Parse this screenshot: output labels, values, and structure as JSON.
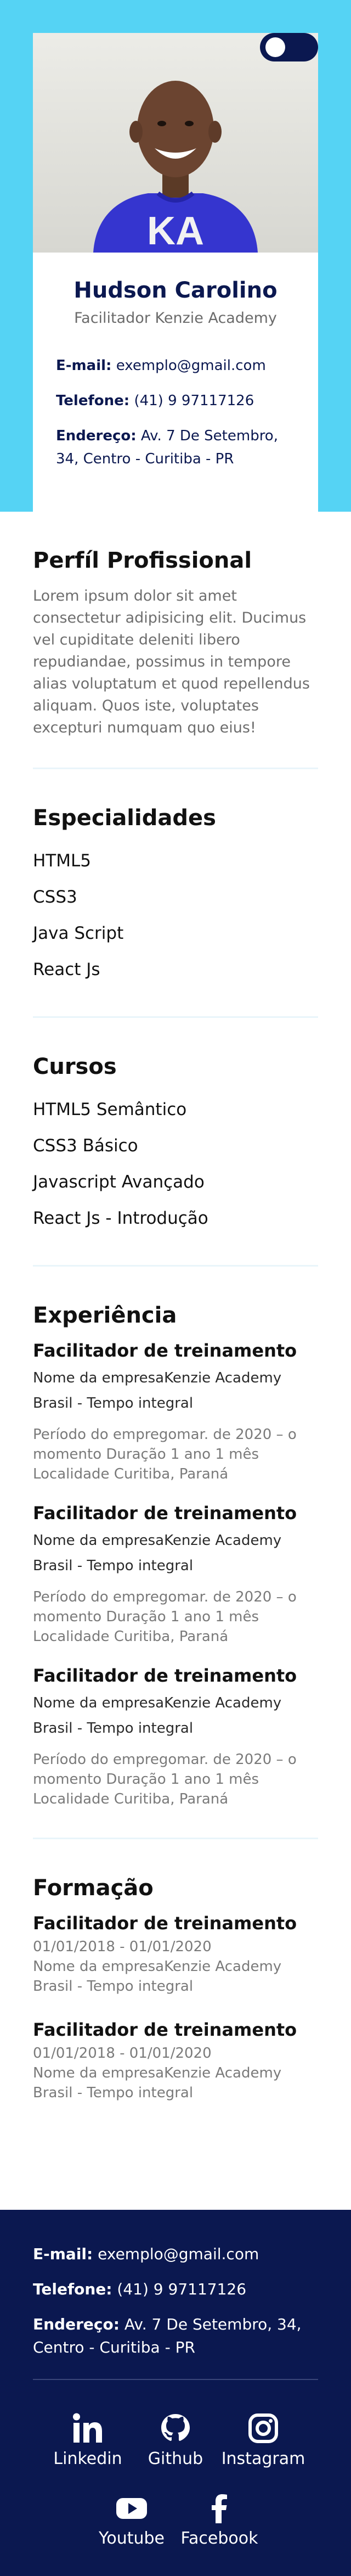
{
  "profile": {
    "name": "Hudson Carolino",
    "role": "Facilitador Kenzie Academy",
    "email_label": "E-mail:",
    "email": "exemplo@gmail.com",
    "phone_label": "Telefone:",
    "phone": "(41) 9 97117126",
    "address_label": "Endereço:",
    "address": "Av. 7 De Setembro, 34, Centro - Curitiba - PR",
    "shirt_logo": "KA"
  },
  "theme": {
    "accent": "#55d3f4",
    "navy": "#0b1850"
  },
  "about": {
    "title": "Perfíl Profissional",
    "text": "Lorem ipsum dolor sit amet consectetur adipisicing elit. Ducimus vel cupiditate deleniti libero repudiandae, possimus in tempore alias voluptatum et quod repellendus aliquam. Quos iste, voluptates excepturi numquam quo eius!"
  },
  "skills": {
    "title": "Especialidades",
    "items": [
      "HTML5",
      "CSS3",
      "Java Script",
      "React Js"
    ]
  },
  "courses": {
    "title": "Cursos",
    "items": [
      "HTML5 Semântico",
      "CSS3 Básico",
      "Javascript Avançado",
      "React Js - Introdução"
    ]
  },
  "experience": {
    "title": "Experiência",
    "items": [
      {
        "role": "Facilitador de treinamento",
        "company": "Nome da empresaKenzie Academy Brasil - Tempo integral",
        "period": "Período do empregomar. de 2020 – o momento Duração 1 ano 1 mês Localidade Curitiba, Paraná"
      },
      {
        "role": "Facilitador de treinamento",
        "company": "Nome da empresaKenzie Academy Brasil - Tempo integral",
        "period": "Período do empregomar. de 2020 – o momento Duração 1 ano 1 mês Localidade Curitiba, Paraná"
      },
      {
        "role": "Facilitador de treinamento",
        "company": "Nome da empresaKenzie Academy Brasil - Tempo integral",
        "period": "Período do empregomar. de 2020 – o momento Duração 1 ano 1 mês Localidade Curitiba, Paraná"
      }
    ]
  },
  "education": {
    "title": "Formação",
    "items": [
      {
        "title": "Facilitador de treinamento",
        "dates": "01/01/2018 - 01/01/2020",
        "school": "Nome da empresaKenzie Academy Brasil - Tempo integral"
      },
      {
        "title": "Facilitador de treinamento",
        "dates": "01/01/2018 - 01/01/2020",
        "school": "Nome da empresaKenzie Academy Brasil - Tempo integral"
      }
    ]
  },
  "footer": {
    "email_label": "E-mail:",
    "email": "exemplo@gmail.com",
    "phone_label": "Telefone:",
    "phone": "(41) 9 97117126",
    "address_label": "Endereço:",
    "address": "Av. 7 De Setembro, 34, Centro - Curitiba - PR",
    "socials": [
      {
        "label": "Linkedin",
        "icon": "linkedin-icon"
      },
      {
        "label": "Github",
        "icon": "github-icon"
      },
      {
        "label": "Instagram",
        "icon": "instagram-icon"
      },
      {
        "label": "Youtube",
        "icon": "youtube-icon"
      },
      {
        "label": "Facebook",
        "icon": "facebook-icon"
      }
    ]
  }
}
